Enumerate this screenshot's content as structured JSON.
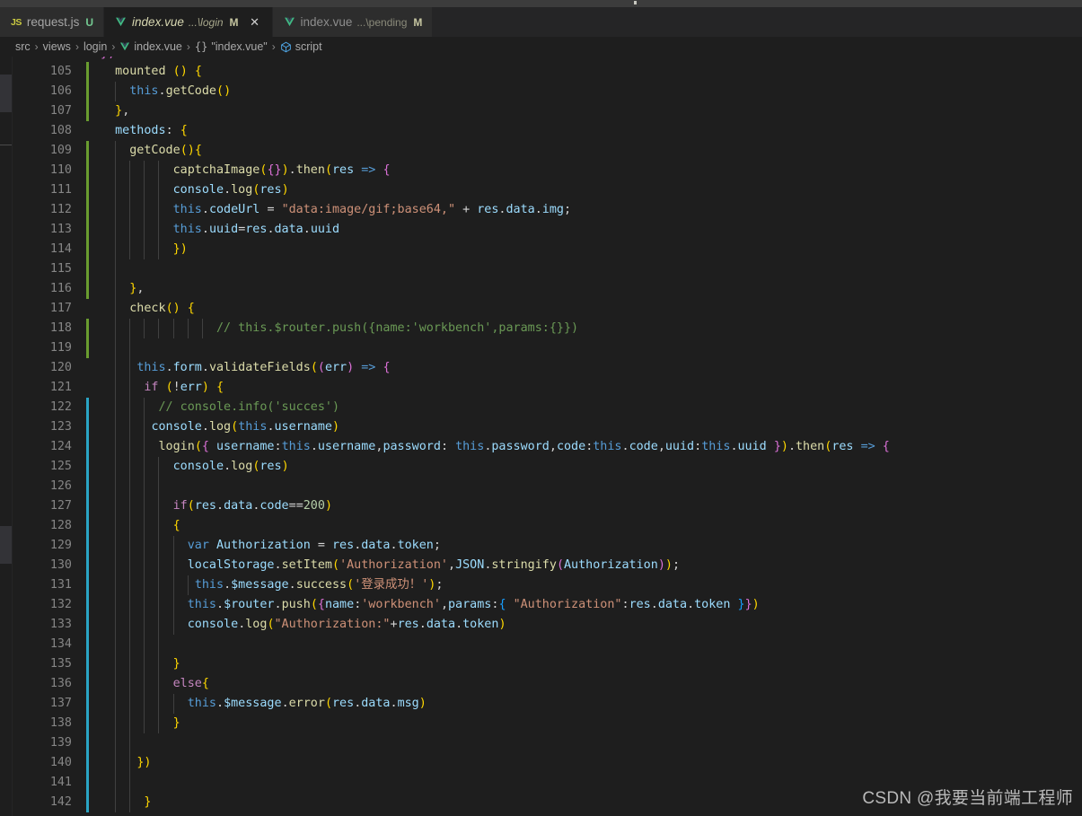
{
  "window": {
    "title_bar_color": "#3c3c3c",
    "editor_bg": "#1e1e1e",
    "tabbar_bg": "#252526"
  },
  "tabs": [
    {
      "icon": "js-file-icon",
      "icon_label": "JS",
      "name": "request.js",
      "path": "",
      "badge": "U",
      "active": false,
      "closable": false
    },
    {
      "icon": "vue-file-icon",
      "icon_label": "",
      "name": "index.vue",
      "path": "...\\login",
      "badge": "M",
      "active": true,
      "closable": true,
      "close_label": "✕"
    },
    {
      "icon": "vue-file-icon",
      "icon_label": "",
      "name": "index.vue",
      "path": "...\\pending",
      "badge": "M",
      "active": false,
      "closable": false
    }
  ],
  "breadcrumb": {
    "separator": "›",
    "items": [
      {
        "label": "src",
        "icon": ""
      },
      {
        "label": "views",
        "icon": ""
      },
      {
        "label": "login",
        "icon": ""
      },
      {
        "label": "index.vue",
        "icon": "vue-file-icon"
      },
      {
        "label": "\"index.vue\"",
        "icon": "braces-icon"
      },
      {
        "label": "script",
        "icon": "symbol-module-icon"
      }
    ]
  },
  "editor": {
    "partial_top_line": "},",
    "first_line_number": 105,
    "lines": [
      {
        "n": 105,
        "git": "mod",
        "text": "  mounted () {"
      },
      {
        "n": 106,
        "git": "mod",
        "text": "    this.getCode()"
      },
      {
        "n": 107,
        "git": "mod",
        "text": "  },"
      },
      {
        "n": 108,
        "git": "",
        "text": "  methods: {"
      },
      {
        "n": 109,
        "git": "mod",
        "text": "    getCode(){"
      },
      {
        "n": 110,
        "git": "mod",
        "text": "          captchaImage({}).then(res => {"
      },
      {
        "n": 111,
        "git": "mod",
        "text": "          console.log(res)"
      },
      {
        "n": 112,
        "git": "mod",
        "text": "          this.codeUrl = \"data:image/gif;base64,\" + res.data.img;"
      },
      {
        "n": 113,
        "git": "mod",
        "text": "          this.uuid=res.data.uuid"
      },
      {
        "n": 114,
        "git": "mod",
        "text": "          })"
      },
      {
        "n": 115,
        "git": "mod",
        "text": ""
      },
      {
        "n": 116,
        "git": "mod",
        "text": "    },"
      },
      {
        "n": 117,
        "git": "",
        "text": "    check() {"
      },
      {
        "n": 118,
        "git": "mod",
        "text": "                // this.$router.push({name:'workbench',params:{}})"
      },
      {
        "n": 119,
        "git": "mod",
        "text": ""
      },
      {
        "n": 120,
        "git": "",
        "text": "     this.form.validateFields((err) => {"
      },
      {
        "n": 121,
        "git": "",
        "text": "      if (!err) {"
      },
      {
        "n": 122,
        "git": "cur",
        "text": "        // console.info('succes')"
      },
      {
        "n": 123,
        "git": "cur",
        "text": "       console.log(this.username)"
      },
      {
        "n": 124,
        "git": "cur",
        "text": "        login({ username:this.username,password: this.password,code:this.code,uuid:this.uuid }).then(res => {"
      },
      {
        "n": 125,
        "git": "cur",
        "text": "          console.log(res)"
      },
      {
        "n": 126,
        "git": "cur",
        "text": ""
      },
      {
        "n": 127,
        "git": "cur",
        "text": "          if(res.data.code==200)"
      },
      {
        "n": 128,
        "git": "cur",
        "text": "          {"
      },
      {
        "n": 129,
        "git": "cur",
        "text": "            var Authorization = res.data.token;"
      },
      {
        "n": 130,
        "git": "cur",
        "text": "            localStorage.setItem('Authorization',JSON.stringify(Authorization));"
      },
      {
        "n": 131,
        "git": "cur",
        "text": "             this.$message.success('登录成功！');"
      },
      {
        "n": 132,
        "git": "cur",
        "text": "            this.$router.push({name:'workbench',params:{ \"Authorization\":res.data.token }})"
      },
      {
        "n": 133,
        "git": "cur",
        "text": "            console.log(\"Authorization:\"+res.data.token)"
      },
      {
        "n": 134,
        "git": "cur",
        "text": ""
      },
      {
        "n": 135,
        "git": "cur",
        "text": "          }"
      },
      {
        "n": 136,
        "git": "cur",
        "text": "          else{"
      },
      {
        "n": 137,
        "git": "cur",
        "text": "            this.$message.error(res.data.msg)"
      },
      {
        "n": 138,
        "git": "cur",
        "text": "          }"
      },
      {
        "n": 139,
        "git": "cur",
        "text": ""
      },
      {
        "n": 140,
        "git": "cur",
        "text": "     })"
      },
      {
        "n": 141,
        "git": "cur",
        "text": ""
      },
      {
        "n": 142,
        "git": "cur",
        "text": "      }"
      }
    ]
  },
  "watermark": {
    "text": "CSDN @我要当前端工程师"
  }
}
